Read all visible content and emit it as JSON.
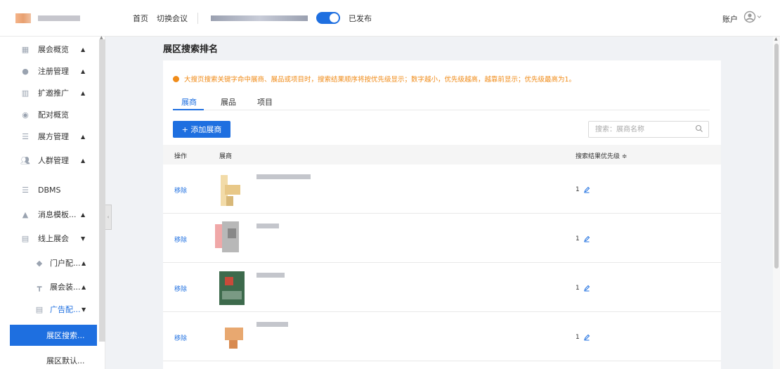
{
  "header": {
    "nav": [
      "首页",
      "切换会议"
    ],
    "publish_status": "已发布",
    "account": "账户"
  },
  "sidebar": {
    "items": [
      {
        "label": "展会概览",
        "icon": "grid-icon",
        "arrow": "▲"
      },
      {
        "label": "注册管理",
        "icon": "user-icon",
        "arrow": "▲"
      },
      {
        "label": "扩邀推广",
        "icon": "chart-icon",
        "arrow": "▲"
      },
      {
        "label": "配对概览",
        "icon": "circle-icon",
        "arrow": ""
      },
      {
        "label": "展方管理",
        "icon": "list-icon",
        "arrow": "▲"
      },
      {
        "label": "人群管理",
        "icon": "group-icon",
        "arrow": "▲"
      },
      {
        "label": "DBMS",
        "icon": "database-icon",
        "arrow": ""
      },
      {
        "label": "消息模板...",
        "icon": "bell-icon",
        "arrow": "▲"
      },
      {
        "label": "线上展会",
        "icon": "monitor-icon",
        "arrow": "▼"
      },
      {
        "label": "门户配...",
        "icon": "tag-icon",
        "arrow": "▲"
      },
      {
        "label": "展会装...",
        "icon": "brush-icon",
        "arrow": "▲"
      },
      {
        "label": "广告配...",
        "icon": "monitor-icon",
        "arrow": "▼"
      },
      {
        "label": "展区搜索...",
        "icon": "",
        "arrow": ""
      },
      {
        "label": "展区默认...",
        "icon": "",
        "arrow": ""
      }
    ]
  },
  "main": {
    "title": "展区搜索排名",
    "notice": "大搜页搜索关键字命中展商、展品或项目时，搜索结果顺序将按优先级显示；数字越小，优先级越高，越靠前显示；优先级最高为1。",
    "tabs": [
      "展商",
      "展品",
      "项目"
    ],
    "add_button": "+ 添加展商",
    "search_placeholder": "搜索：展商名称",
    "table": {
      "headers": [
        "操作",
        "展商",
        "搜索结果优先级 ≑"
      ],
      "rows": [
        {
          "action": "移除",
          "priority": "1"
        },
        {
          "action": "移除",
          "priority": "1"
        },
        {
          "action": "移除",
          "priority": "1"
        },
        {
          "action": "移除",
          "priority": "1"
        }
      ]
    }
  },
  "colors": {
    "primary": "#1e6fe0",
    "warning": "#f08c1a"
  }
}
